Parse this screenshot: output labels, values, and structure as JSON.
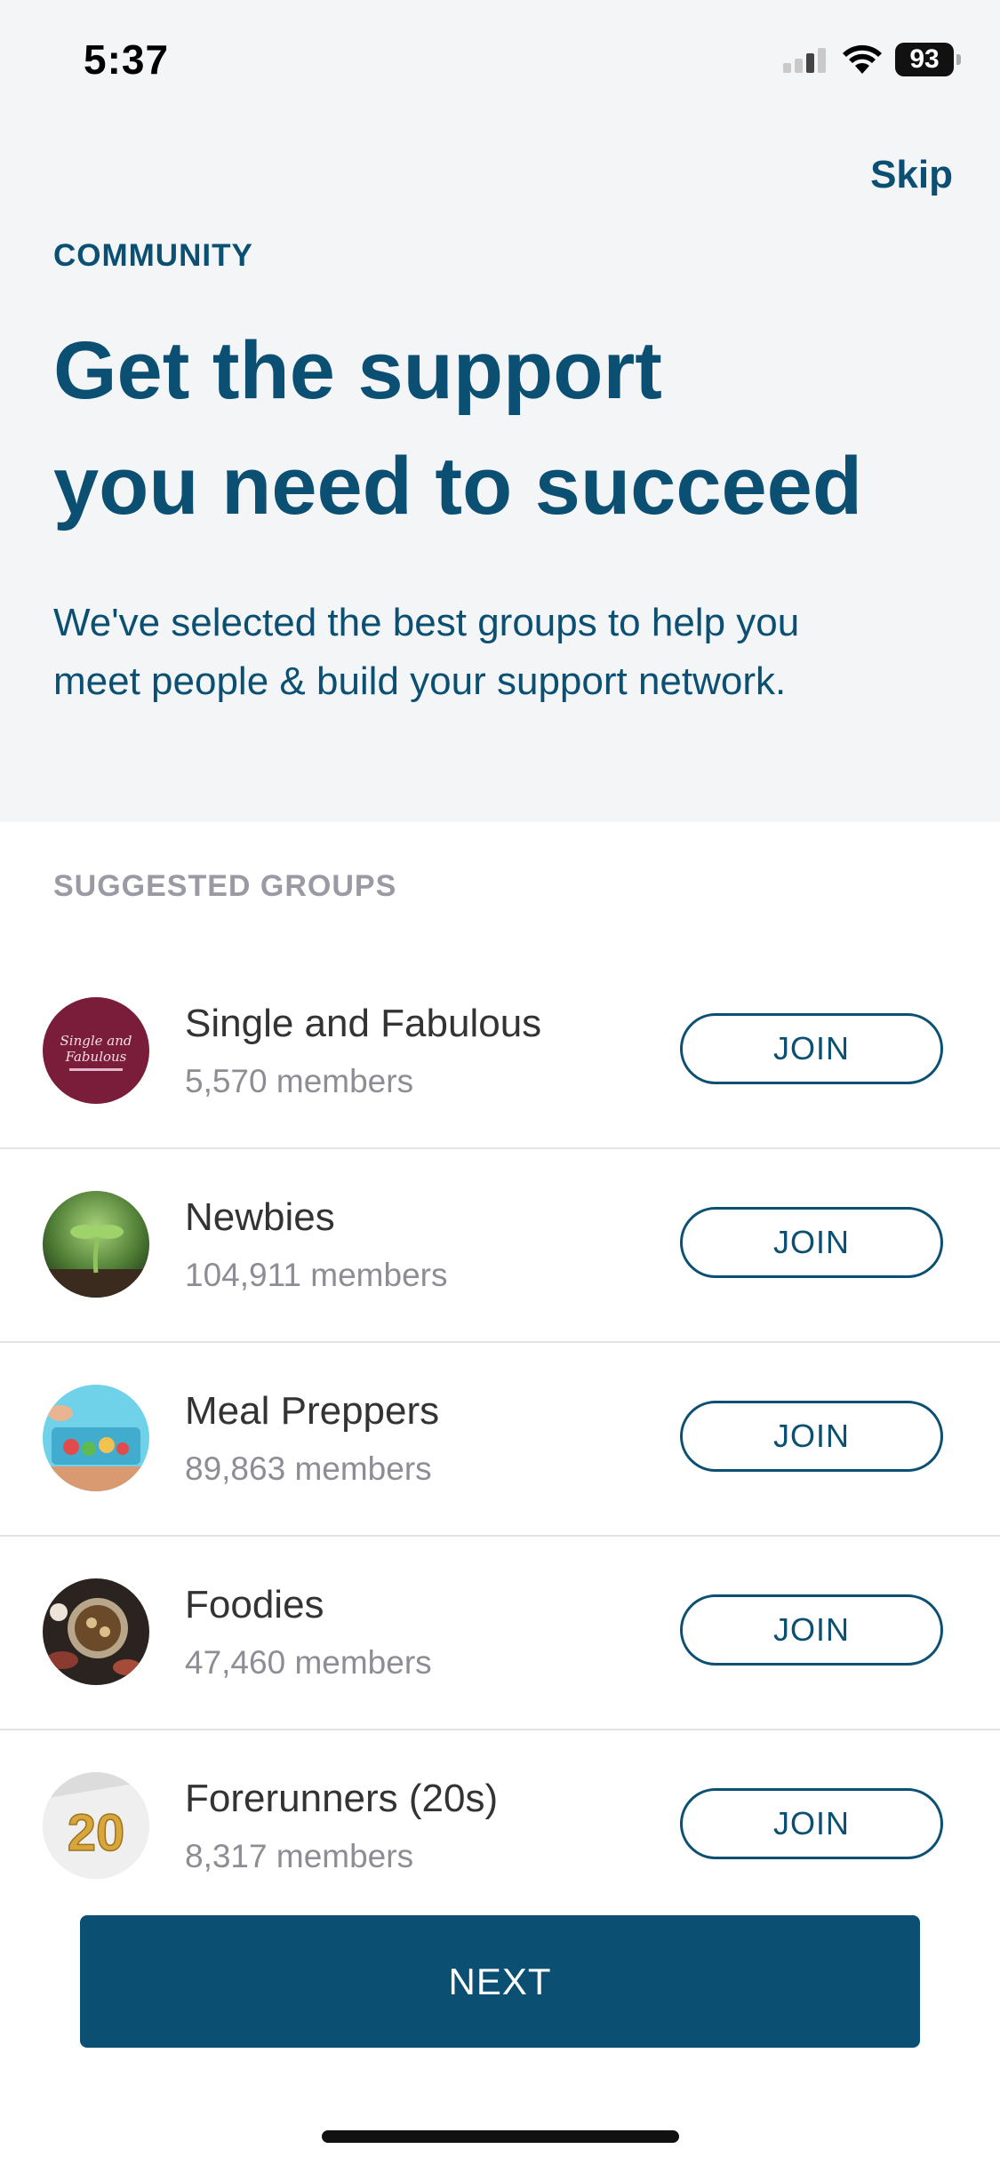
{
  "status_bar": {
    "time": "5:37",
    "battery": "93"
  },
  "header": {
    "skip_label": "Skip",
    "eyebrow": "COMMUNITY",
    "headline_line1": "Get the support",
    "headline_line2": "you need to succeed",
    "subtitle_line1": "We've selected the best groups to help you",
    "subtitle_line2": "meet people & build your support network."
  },
  "section": {
    "title": "SUGGESTED GROUPS"
  },
  "groups": [
    {
      "name": "Single and Fabulous",
      "members": "5,570 members",
      "join_label": "JOIN",
      "avatar_text": "Single and Fabulous"
    },
    {
      "name": "Newbies",
      "members": "104,911 members",
      "join_label": "JOIN"
    },
    {
      "name": "Meal Preppers",
      "members": "89,863 members",
      "join_label": "JOIN"
    },
    {
      "name": "Foodies",
      "members": "47,460 members",
      "join_label": "JOIN"
    },
    {
      "name": "Forerunners (20s)",
      "members": "8,317 members",
      "join_label": "JOIN",
      "avatar_text": "20"
    }
  ],
  "footer": {
    "next_label": "NEXT"
  }
}
